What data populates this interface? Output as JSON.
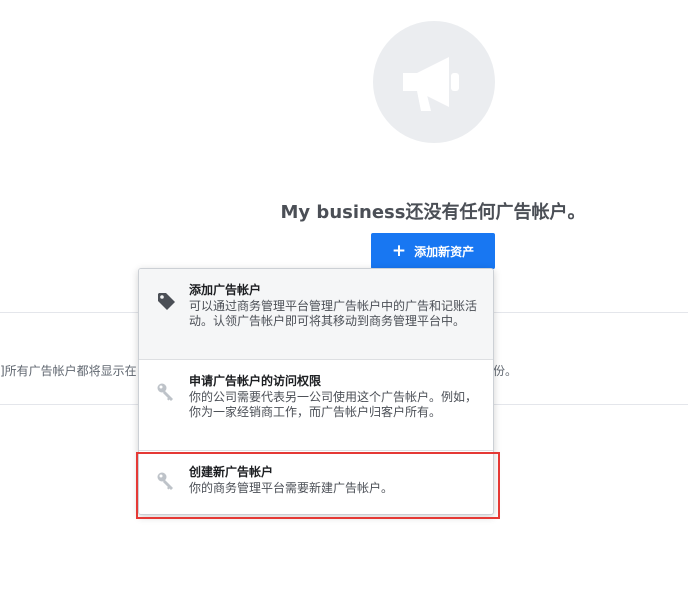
{
  "background": {
    "left_text": "]所有广告帐户都将显示在",
    "right_text": "份。"
  },
  "empty_state": {
    "title": "My business还没有任何广告帐户。",
    "icon": "megaphone-icon"
  },
  "add_button": {
    "icon": "plus-icon",
    "label": "添加新资产"
  },
  "dropdown": {
    "items": [
      {
        "icon": "tag-icon",
        "title": "添加广告帐户",
        "description": "可以通过商务管理平台管理广告帐户中的广告和记账活动。认领广告帐户即可将其移动到商务管理平台中。"
      },
      {
        "icon": "key-icon",
        "title": "申请广告帐户的访问权限",
        "description": "你的公司需要代表另一公司使用这个广告帐户。例如，你为一家经销商工作，而广告帐户归客户所有。"
      },
      {
        "icon": "key-icon",
        "title": "创建新广告帐户",
        "description": "你的商务管理平台需要新建广告帐户。"
      }
    ]
  },
  "colors": {
    "primary_blue": "#1877f2",
    "highlight_red": "#e53935",
    "icon_gray": "#bec3c9",
    "tag_dark": "#4b4f56"
  }
}
